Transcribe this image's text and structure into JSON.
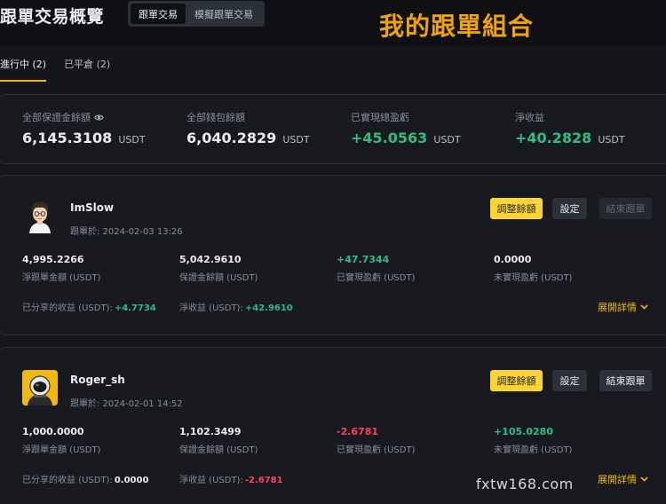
{
  "header": {
    "title": "跟單交易概覽",
    "segments": [
      "跟單交易",
      "模擬跟單交易"
    ],
    "overlay_title": "我的跟單組合"
  },
  "tabs": [
    "進行中 (2)",
    "已平倉 (2)"
  ],
  "summary": {
    "items": [
      {
        "label": "全部保證金餘額",
        "value": "6,145.3108",
        "unit": "USDT"
      },
      {
        "label": "全部錢包餘額",
        "value": "6,040.2829",
        "unit": "USDT"
      },
      {
        "label": "已實現總盈虧",
        "value": "+45.0563",
        "unit": "USDT"
      },
      {
        "label": "淨收益",
        "value": "+40.2828",
        "unit": "USDT"
      }
    ]
  },
  "traders": [
    {
      "name": "ImSlow",
      "since": "跟單於: 2024-02-03 13:26",
      "buttons": {
        "adjust": "調整餘額",
        "settings": "設定",
        "stop": "結束跟單"
      },
      "metrics": [
        {
          "value": "4,995.2266",
          "label": "淨跟單金額 (USDT)"
        },
        {
          "value": "5,042.9610",
          "label": "保證金餘額 (USDT)"
        },
        {
          "value": "+47.7344",
          "label": "已實現盈虧 (USDT)"
        },
        {
          "value": "0.0000",
          "label": "未實現盈虧 (USDT)"
        }
      ],
      "shared_label": "已分享的收益 (USDT):",
      "shared_value": "+4.7734",
      "net_label": "淨收益 (USDT):",
      "net_value": "+42.9610",
      "expand": "展開詳情"
    },
    {
      "name": "Roger_sh",
      "since": "跟單於: 2024-02-01 14:52",
      "buttons": {
        "adjust": "調整餘額",
        "settings": "設定",
        "stop": "結束跟單"
      },
      "metrics": [
        {
          "value": "1,000.0000",
          "label": "淨跟單金額 (USDT)"
        },
        {
          "value": "1,102.3499",
          "label": "保證金餘額 (USDT)"
        },
        {
          "value": "-2.6781",
          "label": "已實現盈虧 (USDT)"
        },
        {
          "value": "+105.0280",
          "label": "未實現盈虧 (USDT)"
        }
      ],
      "shared_label": "已分享的收益 (USDT):",
      "shared_value": "0.0000",
      "net_label": "淨收益 (USDT):",
      "net_value": "-2.6781",
      "expand": "展開詳情"
    }
  ],
  "watermark": "fxtw168.com",
  "colors": {
    "accent": "#fcd535",
    "positive": "#2ebd85",
    "negative": "#f6465d",
    "overlay": "#f0a30a"
  }
}
